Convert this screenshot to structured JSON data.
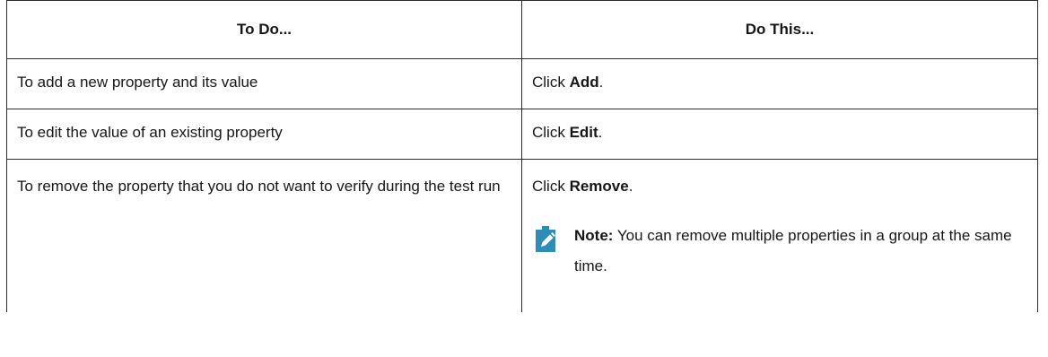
{
  "table": {
    "headers": [
      "To Do...",
      "Do This..."
    ],
    "rows": [
      {
        "todo": "To add a new property and its value",
        "action_prefix": "Click ",
        "action_bold": "Add",
        "action_suffix": "."
      },
      {
        "todo": "To edit the value of an existing property",
        "action_prefix": "Click ",
        "action_bold": "Edit",
        "action_suffix": "."
      },
      {
        "todo": "To remove the property that you do not want to verify during the test run",
        "action_prefix": "Click ",
        "action_bold": "Remove",
        "action_suffix": ".",
        "note_label": "Note:",
        "note_text": " You can remove multiple properties in a group at the same time."
      }
    ]
  },
  "colors": {
    "note_icon": "#2D8DB8",
    "border": "#2b2b2b",
    "text": "#161616"
  },
  "icons": {
    "note": "note-pencil-icon"
  }
}
